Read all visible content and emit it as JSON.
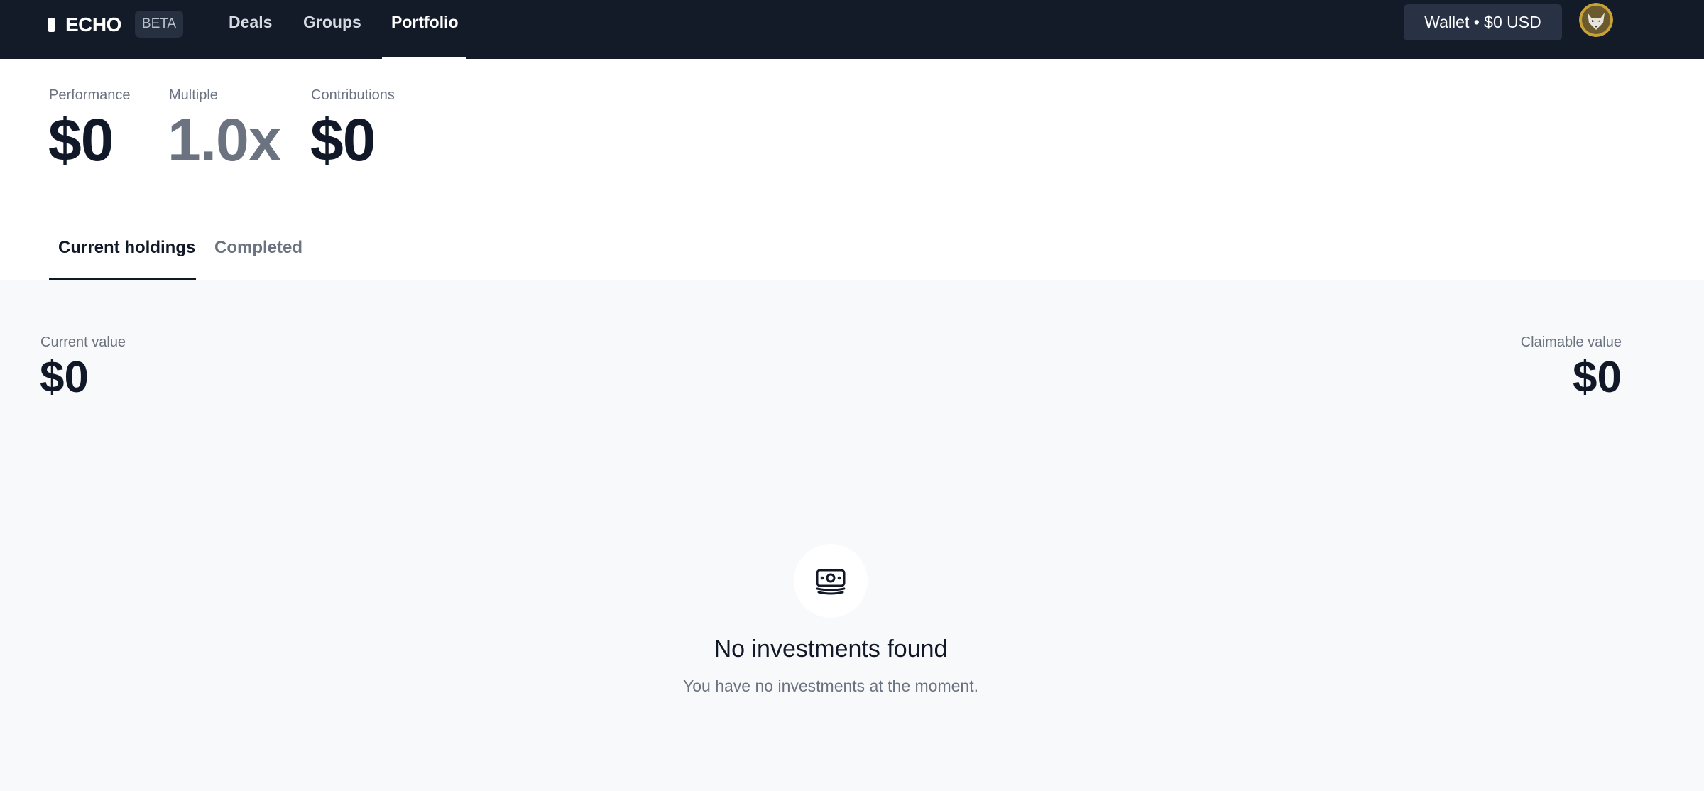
{
  "header": {
    "logo_text": "ECHO",
    "badge": "BETA",
    "nav": [
      {
        "label": "Deals"
      },
      {
        "label": "Groups"
      },
      {
        "label": "Portfolio",
        "active": true
      }
    ],
    "wallet_label": "Wallet • $0 USD",
    "avatar_icon": "wolf-avatar-icon"
  },
  "summary": {
    "performance": {
      "label": "Performance",
      "value": "$0"
    },
    "multiple": {
      "label": "Multiple",
      "value": "1.0x"
    },
    "contributions": {
      "label": "Contributions",
      "value": "$0"
    }
  },
  "tabs": [
    {
      "label": "Current holdings",
      "active": true
    },
    {
      "label": "Completed",
      "active": false
    }
  ],
  "holdings": {
    "current_value": {
      "label": "Current value",
      "value": "$0"
    },
    "claimable_value": {
      "label": "Claimable value",
      "value": "$0"
    }
  },
  "empty_state": {
    "icon": "banknote-icon",
    "title": "No investments found",
    "subtitle": "You have no investments at the moment."
  },
  "colors": {
    "topbar_bg": "#131a28",
    "page_bg": "#f8f9fb",
    "text_primary": "#111827",
    "text_muted": "#6b7280"
  }
}
